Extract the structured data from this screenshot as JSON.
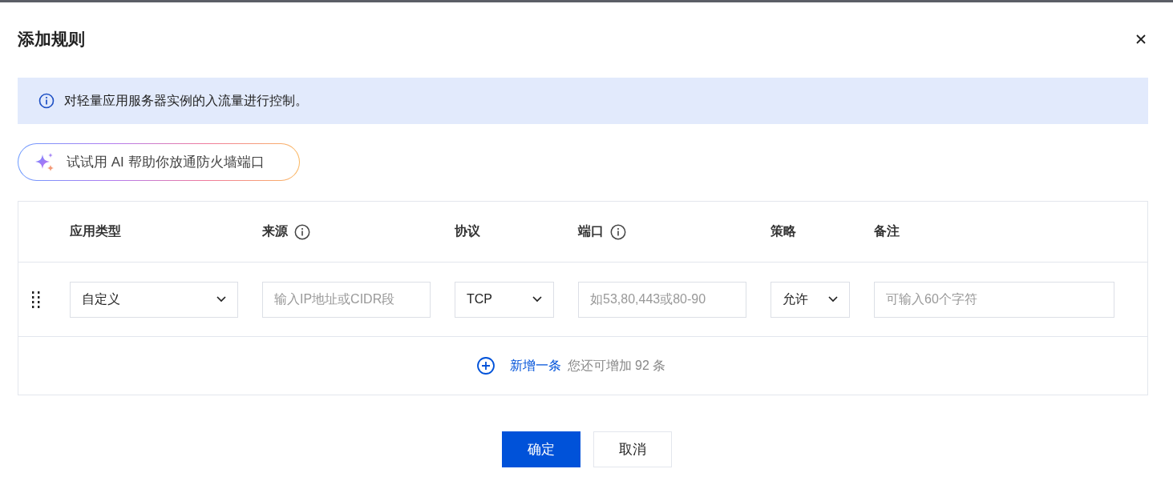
{
  "dialog": {
    "title": "添加规则",
    "notice": "对轻量应用服务器实例的入流量进行控制。",
    "ai_button": "试试用 AI 帮助你放通防火墙端口"
  },
  "table": {
    "columns": [
      {
        "label": "应用类型",
        "has_info": false
      },
      {
        "label": "来源",
        "has_info": true
      },
      {
        "label": "协议",
        "has_info": false
      },
      {
        "label": "端口",
        "has_info": true
      },
      {
        "label": "策略",
        "has_info": false
      },
      {
        "label": "备注",
        "has_info": false
      }
    ],
    "rows": [
      {
        "cells": [
          {
            "kind": "select",
            "value": "自定义"
          },
          {
            "kind": "input",
            "placeholder": "输入IP地址或CIDR段"
          },
          {
            "kind": "select",
            "value": "TCP"
          },
          {
            "kind": "input",
            "placeholder": "如53,80,443或80-90"
          },
          {
            "kind": "select",
            "value": "允许"
          },
          {
            "kind": "input",
            "placeholder": "可输入60个字符"
          }
        ]
      }
    ],
    "add_link": "新增一条",
    "remaining": "您还可增加 92 条"
  },
  "buttons": [
    {
      "label": "确定",
      "kind": "primary"
    },
    {
      "label": "取消",
      "kind": "default"
    }
  ]
}
